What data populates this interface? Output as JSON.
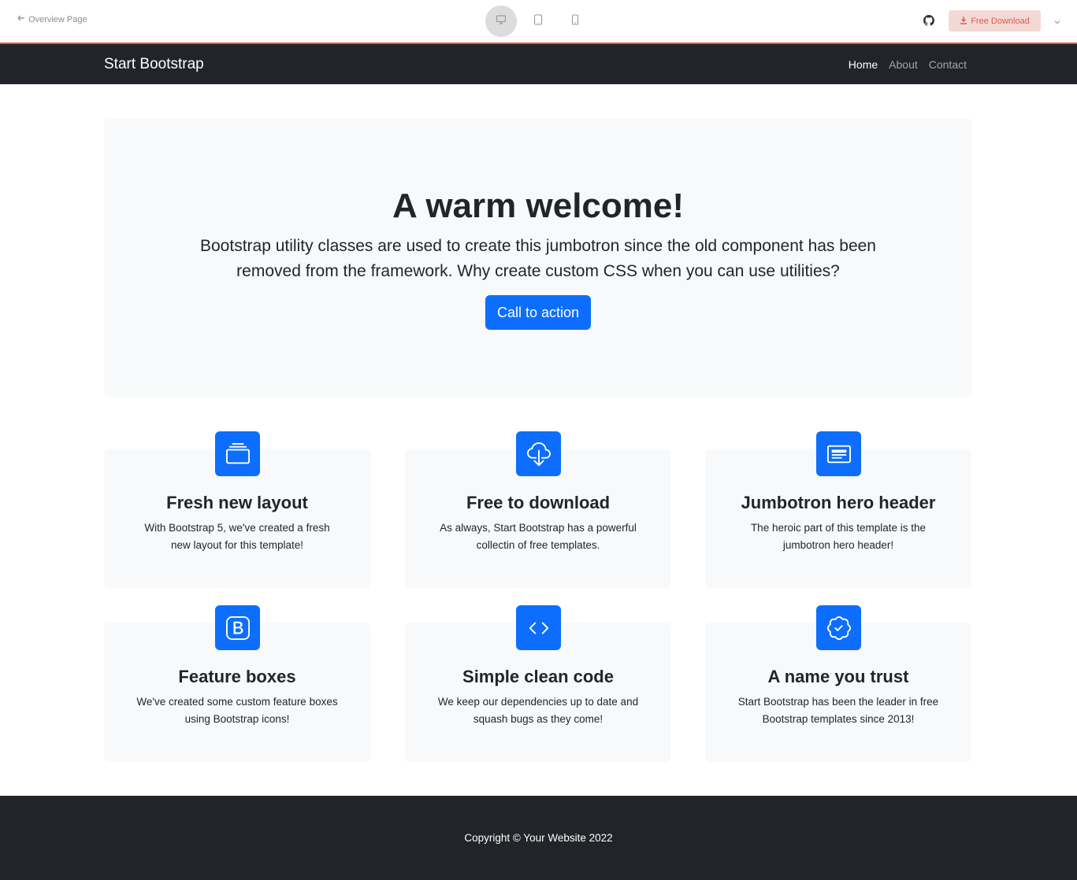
{
  "preview": {
    "back_label": "Overview Page",
    "download_label": "Free Download",
    "devices": [
      "desktop-icon",
      "tablet-icon",
      "phone-icon"
    ],
    "active_device": "desktop",
    "accent_color": "#e05a47"
  },
  "navbar": {
    "brand": "Start Bootstrap",
    "links": [
      {
        "label": "Home",
        "active": true
      },
      {
        "label": "About",
        "active": false
      },
      {
        "label": "Contact",
        "active": false
      }
    ]
  },
  "hero": {
    "title": "A warm welcome!",
    "lead": "Bootstrap utility classes are used to create this jumbotron since the old component has been removed from the framework. Why create custom CSS when you can use utilities?",
    "cta_label": "Call to action",
    "cta_color": "#0d6efd"
  },
  "features": [
    {
      "icon": "collection-icon",
      "title": "Fresh new layout",
      "text": "With Bootstrap 5, we've created a fresh new layout for this template!"
    },
    {
      "icon": "cloud-download-icon",
      "title": "Free to download",
      "text": "As always, Start Bootstrap has a powerful collectin of free templates."
    },
    {
      "icon": "card-heading-icon",
      "title": "Jumbotron hero header",
      "text": "The heroic part of this template is the jumbotron hero header!"
    },
    {
      "icon": "bootstrap-icon",
      "title": "Feature boxes",
      "text": "We've created some custom feature boxes using Bootstrap icons!"
    },
    {
      "icon": "code-icon",
      "title": "Simple clean code",
      "text": "We keep our dependencies up to date and squash bugs as they come!"
    },
    {
      "icon": "patch-check-icon",
      "title": "A name you trust",
      "text": "Start Bootstrap has been the leader in free Bootstrap templates since 2013!"
    }
  ],
  "footer": {
    "copyright": "Copyright © Your Website 2022"
  }
}
